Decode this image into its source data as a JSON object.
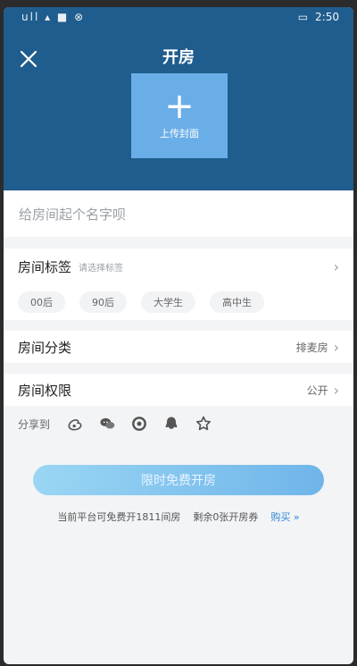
{
  "status": {
    "left_icons": "ull  ▴  ■  ⊗",
    "time": "2:50"
  },
  "header": {
    "title": "开房"
  },
  "upload": {
    "label": "上传封面"
  },
  "room_name": {
    "placeholder": "给房间起个名字呗"
  },
  "tags": {
    "title": "房间标签",
    "subtitle": "请选择标签",
    "items": [
      "00后",
      "90后",
      "大学生",
      "高中生"
    ]
  },
  "category": {
    "title": "房间分类",
    "value": "排麦房"
  },
  "permission": {
    "title": "房间权限",
    "value": "公开"
  },
  "share": {
    "label": "分享到",
    "icons": [
      "weibo-icon",
      "wechat-icon",
      "moments-icon",
      "qq-icon",
      "star-icon"
    ]
  },
  "create": {
    "label": "限时免费开房"
  },
  "footer": {
    "free_text": "当前平台可免费开1811间房",
    "remaining_text": "剩余0张开房券",
    "buy_label": "购买 »"
  },
  "colors": {
    "header_bg": "#1f5d8e",
    "upload_bg": "#6aaee8",
    "button_gradient_start": "#9ad6f3",
    "button_gradient_end": "#6fb5ea",
    "link": "#2c87d7"
  }
}
